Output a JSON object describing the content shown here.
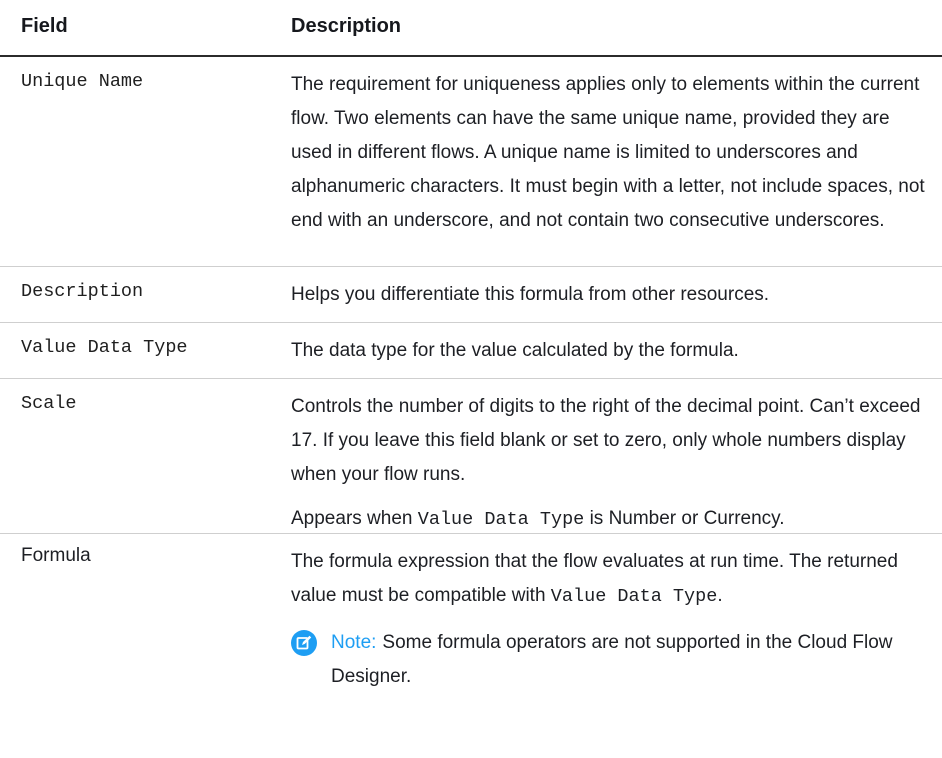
{
  "header": {
    "field": "Field",
    "description": "Description"
  },
  "rows": [
    {
      "field": "Unique Name",
      "description": "The requirement for uniqueness applies only to elements within the current flow. Two elements can have the same unique name, provided they are used in different flows. A unique name is limited to underscores and alphanumeric characters. It must begin with a letter, not include spaces, not end with an underscore, and not contain two consecutive underscores."
    },
    {
      "field": "Description",
      "description": "Helps you differentiate this formula from other resources."
    },
    {
      "field": "Value Data Type",
      "description": "The data type for the value calculated by the formula."
    },
    {
      "field": "Scale",
      "description": "Controls the number of digits to the right of the decimal point. Can’t exceed 17. If you leave this field blank or set to zero, only whole numbers display when your flow runs.",
      "extra_prefix": "Appears when",
      "extra_code": "Value Data Type",
      "extra_suffix": "is Number or Currency."
    },
    {
      "field": "Formula",
      "description_prefix": "The formula expression that the flow evaluates at run time. The returned value must be compatible with",
      "description_code": "Value Data Type",
      "description_suffix": ".",
      "note_label": "Note:",
      "note_text": "Some formula operators are not supported in the Cloud Flow Designer."
    }
  ],
  "colors": {
    "note_accent": "#1e9ef3",
    "header_rule": "#2b2b2b",
    "row_rule": "#cfcfcf"
  },
  "icons": {
    "note": "edit-note-icon"
  }
}
